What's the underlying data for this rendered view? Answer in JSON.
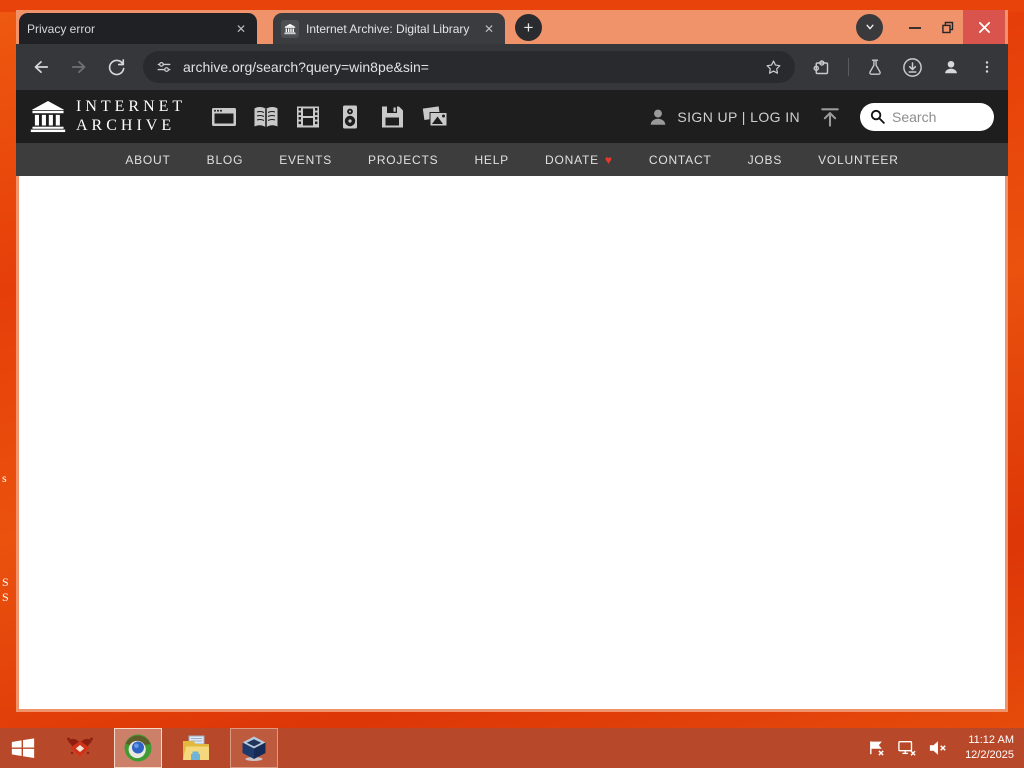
{
  "colors": {
    "frame_salmon": "#f0926a",
    "desktop_orange": "#e8480c",
    "taskbar_red": "#b7492a",
    "toolbar_dark": "#36373b",
    "header_dark": "#1e1e1e",
    "nav_gray": "#3d3d3d",
    "close_button_red": "#d8544c",
    "donate_heart_red": "#e8392b"
  },
  "browser": {
    "tabs": [
      {
        "title": "Privacy error"
      },
      {
        "title": "Internet Archive: Digital Library"
      }
    ],
    "url": "archive.org/search?query=win8pe&sin="
  },
  "header": {
    "logo_line1": "INTERNET",
    "logo_line2": "ARCHIVE",
    "media_types": [
      "web",
      "texts",
      "video",
      "audio",
      "software",
      "images"
    ],
    "signup_login": "SIGN UP | LOG IN",
    "search_placeholder": "Search"
  },
  "nav": {
    "items": [
      "ABOUT",
      "BLOG",
      "EVENTS",
      "PROJECTS",
      "HELP",
      "DONATE",
      "CONTACT",
      "JOBS",
      "VOLUNTEER"
    ]
  },
  "taskbar": {
    "time": "11:12 AM",
    "date": "12/2/2025"
  },
  "desktop": {
    "fragments": [
      "s",
      "S",
      "S"
    ]
  },
  "icons": {
    "close": "✕",
    "plus": "+",
    "heart": "♥"
  }
}
